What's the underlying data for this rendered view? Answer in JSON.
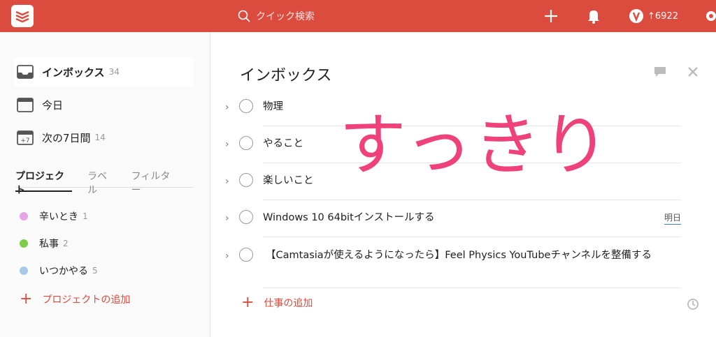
{
  "topbar": {
    "search_placeholder": "クイック検索",
    "karma_points": "6922",
    "karma_arrow": "↑",
    "color": "#db4c3f"
  },
  "sidebar": {
    "nav": [
      {
        "label": "インボックス",
        "count": "34",
        "icon": "inbox-icon"
      },
      {
        "label": "今日",
        "count": "",
        "icon": "calendar-today-icon"
      },
      {
        "label": "次の7日間",
        "count": "14",
        "icon": "calendar-week-icon",
        "icon_text": "+7"
      }
    ],
    "tabs": [
      "プロジェクト",
      "ラベル",
      "フィルター"
    ],
    "projects": [
      {
        "label": "辛いとき",
        "count": "1",
        "color": "#e6a3e6"
      },
      {
        "label": "私事",
        "count": "2",
        "color": "#7ecc49"
      },
      {
        "label": "いつかやる",
        "count": "5",
        "color": "#a8c8e8"
      }
    ],
    "add_project_label": "プロジェクトの追加"
  },
  "main": {
    "title": "インボックス",
    "tasks": [
      {
        "text": "物理",
        "due": ""
      },
      {
        "text": "やること",
        "due": ""
      },
      {
        "text": "楽しいこと",
        "due": ""
      },
      {
        "text": "Windows 10 64bitインストールする",
        "due": "明日"
      },
      {
        "text": "【Camtasiaが使えるようになったら】Feel Physics YouTubeチャンネルを整備する",
        "due": ""
      }
    ],
    "add_task_label": "仕事の追加"
  },
  "overlay_text": "すっきり",
  "overlay_color": "#f0427a"
}
